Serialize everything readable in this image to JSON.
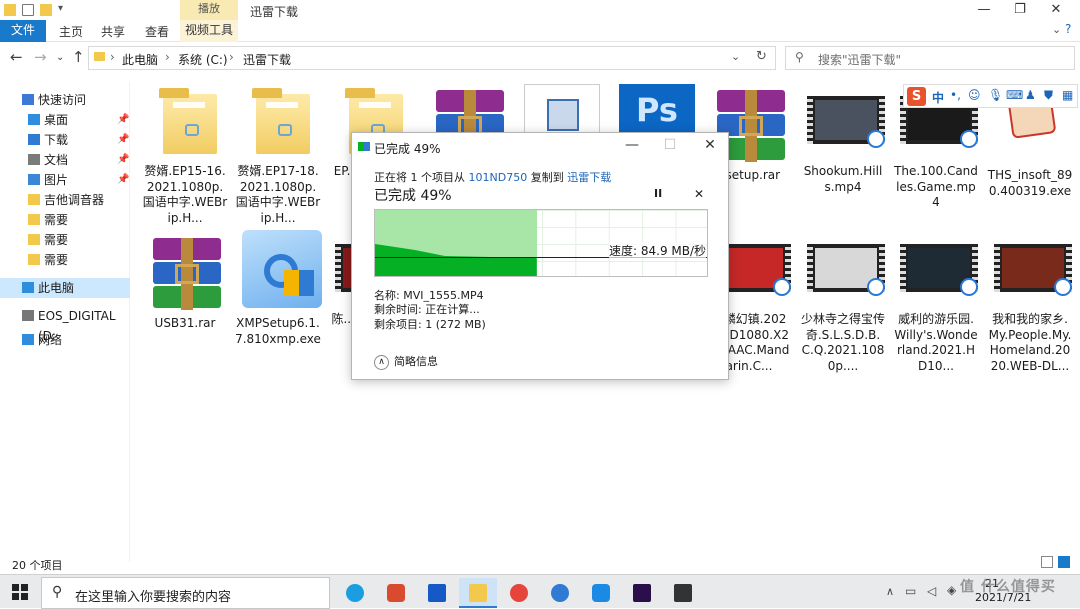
{
  "window": {
    "title": "迅雷下载",
    "context_tab": "播放",
    "controls": [
      "minimize-icon",
      "maximize-icon",
      "close-icon"
    ]
  },
  "ribbon": {
    "tabs": [
      "文件",
      "主页",
      "共享",
      "查看",
      "视频工具"
    ]
  },
  "address": {
    "crumbs": [
      "此电脑",
      "系统 (C:)",
      "迅雷下载"
    ],
    "search_placeholder": "搜索\"迅雷下载\""
  },
  "sidebar": {
    "items": [
      {
        "label": "快速访问",
        "icon": "star-icon",
        "pinned": false
      },
      {
        "label": "桌面",
        "icon": "desktop-icon",
        "pinned": true
      },
      {
        "label": "下载",
        "icon": "download-icon",
        "pinned": true
      },
      {
        "label": "文档",
        "icon": "document-icon",
        "pinned": true
      },
      {
        "label": "图片",
        "icon": "picture-icon",
        "pinned": true
      },
      {
        "label": "吉他调音器",
        "icon": "folder-icon",
        "pinned": false
      },
      {
        "label": "需要",
        "icon": "folder-icon",
        "pinned": false
      },
      {
        "label": "需要",
        "icon": "folder-icon",
        "pinned": false
      },
      {
        "label": "需要",
        "icon": "folder-icon",
        "pinned": false
      },
      {
        "label": "此电脑",
        "icon": "computer-icon",
        "pinned": false
      },
      {
        "label": "EOS_DIGITAL (D:",
        "icon": "drive-icon",
        "pinned": false
      },
      {
        "label": "网络",
        "icon": "network-icon",
        "pinned": false
      }
    ]
  },
  "files": {
    "row1": [
      {
        "name": "赘婿.EP15-16.2021.1080p.国语中字.WEBrip.H...",
        "kind": "folder"
      },
      {
        "name": "赘婿.EP17-18.2021.1080p.国语中字.WEBrip.H...",
        "kind": "folder"
      },
      {
        "name": "EP...10...字...",
        "kind": "folder"
      },
      {
        "name": "",
        "kind": "rar"
      },
      {
        "name": "",
        "kind": "installer"
      },
      {
        "name": "",
        "kind": "photoshop"
      },
      {
        "name": "nsetup.rar",
        "kind": "rar"
      },
      {
        "name": "Shookum.Hills.mp4",
        "kind": "video"
      },
      {
        "name": "The.100.Candles.Game.mp4",
        "kind": "video"
      },
      {
        "name": "THS_insoft_890.400319.exe",
        "kind": "exe"
      }
    ],
    "row2": [
      {
        "name": "USB31.rar",
        "kind": "rar"
      },
      {
        "name": "XMPSetup6.1.7.810xmp.exe",
        "kind": "exe"
      },
      {
        "name": "陈...20...P.X...",
        "kind": "video"
      },
      {
        "name": "麒麟幻镇.2021.HD1080.X264.AAC.Mandarin.C...",
        "kind": "video"
      },
      {
        "name": "少林寺之得宝传奇.S.L.S.D.B.C.Q.2021.1080p....",
        "kind": "video"
      },
      {
        "name": "威利的游乐园.Willy's.Wonderland.2021.HD10...",
        "kind": "video"
      },
      {
        "name": "我和我的家乡.My.People.My.Homeland.2020.WEB-DL...",
        "kind": "video"
      }
    ]
  },
  "dialog": {
    "title": "已完成 49%",
    "line_prefix": "正在将 1 个项目从 ",
    "source": "101ND750",
    "line_mid": " 复制到 ",
    "dest": "迅雷下载",
    "progress_text": "已完成 49%",
    "progress_fraction": 0.49,
    "speed_text": "速度: 84.9 MB/秒",
    "name_label": "名称: MVI_1555.MP4",
    "time_label": "剩余时间: 正在计算...",
    "items_label": "剩余项目: 1 (272 MB)",
    "details_label": "简略信息",
    "pause_icon": "pause-icon",
    "cancel_icon": "close-icon",
    "accent": "#06b025"
  },
  "status": {
    "count": "20 个项目"
  },
  "taskbar": {
    "search_placeholder": "在这里输入你要搜索的内容",
    "date": "2021/7/21",
    "time_partial": "21",
    "watermark": "值 什么值得买"
  }
}
